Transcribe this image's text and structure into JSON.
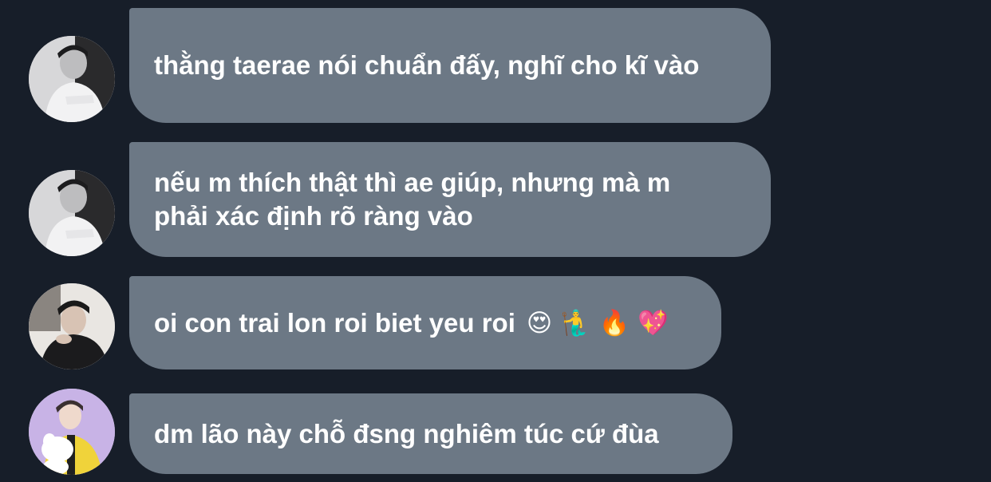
{
  "messages": [
    {
      "text": "thằng taerae nói chuẩn đấy, nghĩ cho kĩ vào",
      "avatar": "user-avatar-1"
    },
    {
      "text": "nếu m thích thật thì ae giúp, nhưng mà m phải xác định rõ ràng vào",
      "avatar": "user-avatar-1"
    },
    {
      "text": "oi con trai lon roi biet yeu roi",
      "emoji": "😍 🧜‍♂️ 🔥 💖",
      "avatar": "user-avatar-2"
    },
    {
      "text": "dm lão này chỗ đsng nghiêm túc cứ đùa",
      "avatar": "user-avatar-3"
    }
  ],
  "colors": {
    "background": "#171e29",
    "bubble": "#6c7885",
    "text": "#ffffff"
  }
}
